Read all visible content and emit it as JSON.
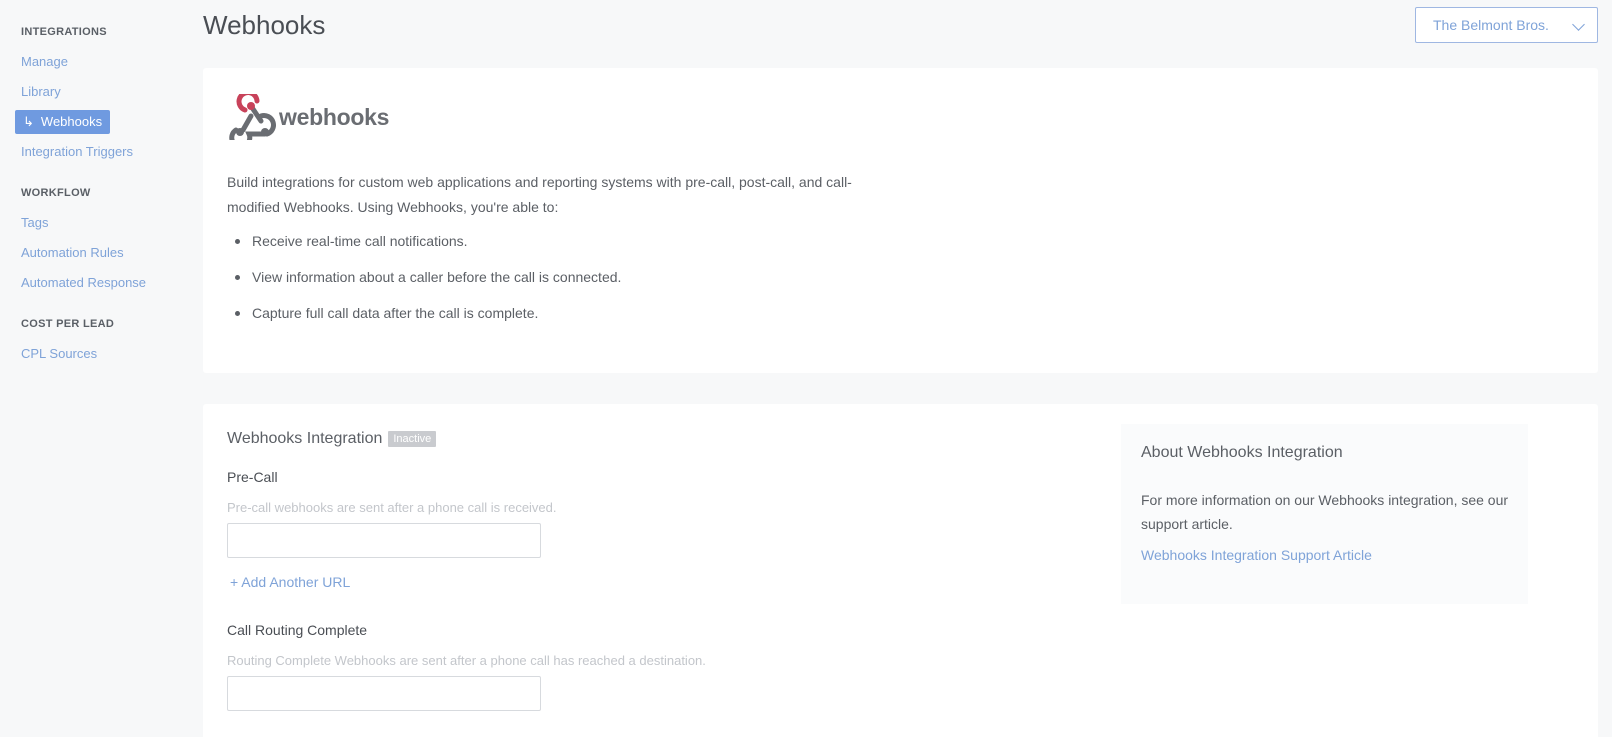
{
  "sidebar": {
    "sections": [
      {
        "title": "INTEGRATIONS",
        "items": [
          {
            "label": "Manage"
          },
          {
            "label": "Library"
          },
          {
            "label": "Webhooks",
            "active": true
          },
          {
            "label": "Integration Triggers"
          }
        ]
      },
      {
        "title": "WORKFLOW",
        "items": [
          {
            "label": "Tags"
          },
          {
            "label": "Automation Rules"
          },
          {
            "label": "Automated Response"
          }
        ]
      },
      {
        "title": "COST PER LEAD",
        "items": [
          {
            "label": "CPL Sources"
          }
        ]
      }
    ],
    "active_arrow": "↳"
  },
  "header": {
    "title": "Webhooks",
    "account": "The Belmont Bros."
  },
  "intro": {
    "logo_text": "webhooks",
    "description": "Build integrations for custom web applications and reporting systems with pre-call, post-call, and call-modified Webhooks. Using Webhooks, you're able to:",
    "bullets": [
      "Receive real-time call notifications.",
      "View information about a caller before the call is connected.",
      "Capture full call data after the call is complete."
    ]
  },
  "integration": {
    "title": "Webhooks Integration",
    "status": "Inactive",
    "precall": {
      "label": "Pre-Call",
      "help": "Pre-call webhooks are sent after a phone call is received.",
      "value": "",
      "add_url": "+ Add Another URL"
    },
    "routing": {
      "label": "Call Routing Complete",
      "help": "Routing Complete Webhooks are sent after a phone call has reached a destination.",
      "value": ""
    },
    "about": {
      "title": "About Webhooks Integration",
      "text": "For more information on our Webhooks integration, see our support article.",
      "link": "Webhooks Integration Support Article"
    }
  },
  "colors": {
    "accent": "#7fa3d8",
    "active_bg": "#6f9ae0",
    "badge_bg": "#c9cbcf",
    "logo_red": "#c8425a",
    "logo_gray": "#6a6d72"
  },
  "icons": {
    "logo": "webhooks-logo-icon",
    "account_chevron": "chevron-down-icon"
  }
}
